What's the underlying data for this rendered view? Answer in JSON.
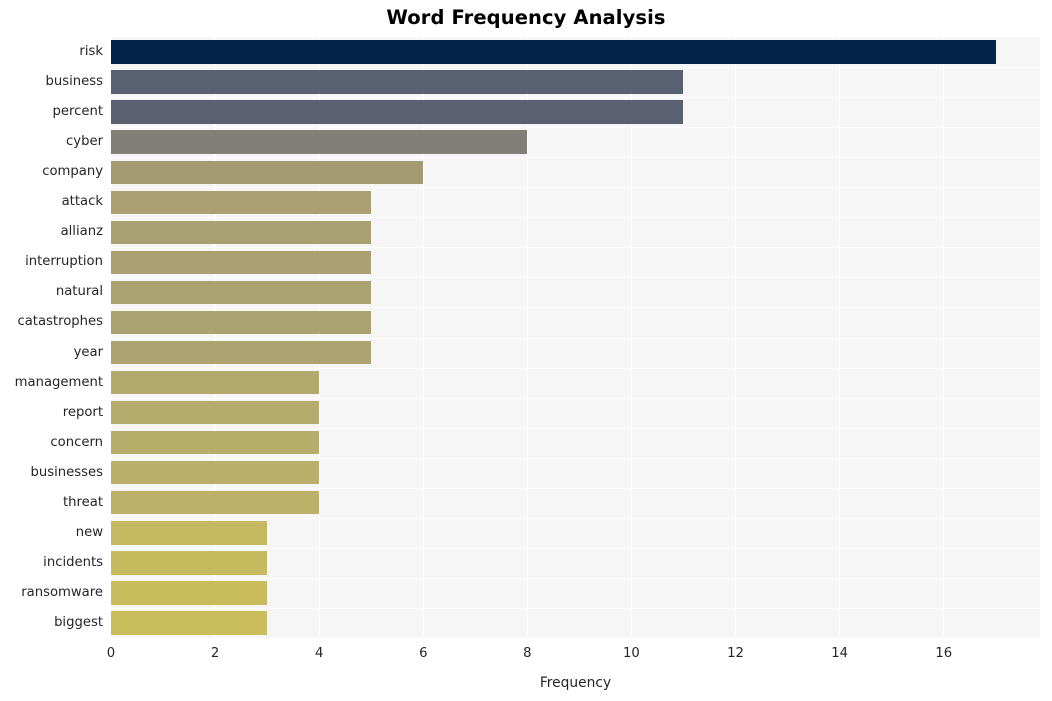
{
  "chart_data": {
    "type": "bar",
    "orientation": "horizontal",
    "title": "Word Frequency Analysis",
    "xlabel": "Frequency",
    "ylabel": "",
    "xlim": [
      0,
      17.85
    ],
    "xticks": [
      0,
      2,
      4,
      6,
      8,
      10,
      12,
      14,
      16
    ],
    "xticklabels": [
      "0",
      "2",
      "4",
      "6",
      "8",
      "10",
      "12",
      "14",
      "16"
    ],
    "grid": true,
    "grid_axis": "x",
    "legend": null,
    "categories": [
      "risk",
      "business",
      "percent",
      "cyber",
      "company",
      "attack",
      "allianz",
      "interruption",
      "natural",
      "catastrophes",
      "year",
      "management",
      "report",
      "concern",
      "businesses",
      "threat",
      "new",
      "incidents",
      "ransomware",
      "biggest"
    ],
    "values": [
      17,
      11,
      11,
      8,
      6,
      5,
      5,
      5,
      5,
      5,
      5,
      4,
      4,
      4,
      4,
      4,
      3,
      3,
      3,
      3
    ],
    "bar_colors": [
      "#04244c",
      "#59606f",
      "#5b6071",
      "#827f78",
      "#a49a72",
      "#a99f71",
      "#a9a071",
      "#aaa071",
      "#aba271",
      "#ab a271",
      "#aca371",
      "#b3a96d",
      "#b5ab6c",
      "#b7ad6b",
      "#b9af6a",
      "#bbb168",
      "#c4b860",
      "#c6ba5e",
      "#c8bc5d",
      "#c9bd5c"
    ],
    "plot_background": "#f6f6f6",
    "gridline_color": "#ffffff",
    "text_color": "#262626",
    "figure_background": "#ffffff"
  }
}
